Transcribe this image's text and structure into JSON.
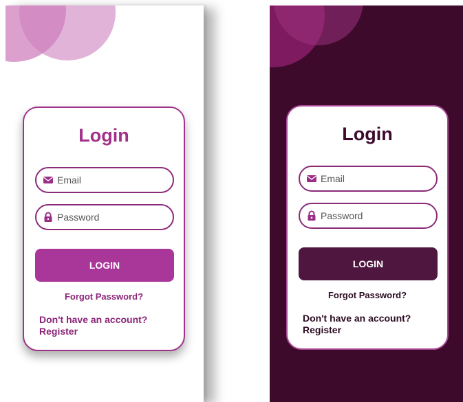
{
  "colors": {
    "light_accent": "#a9379a",
    "dark_background": "#3d0a2c",
    "dark_button": "#4f1740",
    "card_border": "#a0328a"
  },
  "screens": {
    "light": {
      "title": "Login",
      "email_placeholder": "Email",
      "password_placeholder": "Password",
      "login_label": "LOGIN",
      "forgot_label": "Forgot Password?",
      "no_account_text": "Don't have an account?",
      "register_label": "Register"
    },
    "dark": {
      "title": "Login",
      "email_placeholder": "Email",
      "password_placeholder": "Password",
      "login_label": "LOGIN",
      "forgot_label": "Forgot Password?",
      "no_account_text": "Don't have an account?",
      "register_label": "Register"
    }
  },
  "icons": {
    "email": "envelope-icon",
    "password": "lock-icon"
  }
}
